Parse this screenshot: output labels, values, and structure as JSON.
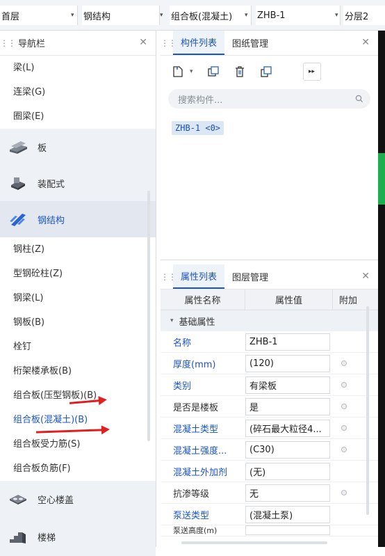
{
  "topbar": {
    "floor": "首层",
    "category": "钢结构",
    "component_type": "组合板(混凝土)",
    "component": "ZHB-1",
    "layer": "分层2"
  },
  "nav": {
    "title": "导航栏",
    "items_top": [
      "梁(L)",
      "连梁(G)",
      "圈梁(E)"
    ],
    "cat_slab": "板",
    "cat_prefab": "装配式",
    "cat_steel": "钢结构",
    "steel_items": [
      "钢柱(Z)",
      "型钢砼柱(Z)",
      "钢梁(L)",
      "钢板(B)",
      "栓钉",
      "桁架楼承板(B)",
      "组合板(压型钢板)(B)",
      "组合板(混凝土)(B)",
      "组合板受力筋(S)",
      "组合板负筋(F)"
    ],
    "cat_hollow": "空心楼盖",
    "cat_stairs": "楼梯"
  },
  "component_panel": {
    "tab_list": "构件列表",
    "tab_drawings": "图纸管理",
    "search_placeholder": "搜索构件...",
    "item": "ZHB-1 <0>"
  },
  "property_panel": {
    "tab_props": "属性列表",
    "tab_layers": "图层管理",
    "col_name": "属性名称",
    "col_value": "属性值",
    "col_extra": "附加",
    "group": "基础属性",
    "rows": [
      {
        "name": "名称",
        "value": "ZHB-1"
      },
      {
        "name": "厚度(mm)",
        "value": "(120)"
      },
      {
        "name": "类别",
        "value": "有梁板"
      },
      {
        "name": "是否是楼板",
        "value": "是"
      },
      {
        "name": "混凝土类型",
        "value": "(碎石最大粒径4..."
      },
      {
        "name": "混凝土强度...",
        "value": "(C30)"
      },
      {
        "name": "混凝土外加剂",
        "value": "(无)"
      },
      {
        "name": "抗渗等级",
        "value": "无"
      },
      {
        "name": "泵送类型",
        "value": "(混凝土泵)"
      },
      {
        "name": "泵送高度(m)",
        "value": ""
      }
    ]
  },
  "colors": {
    "accent": "#1a55c8",
    "annotation": "#e02020",
    "side_green": "#1dae4d"
  },
  "icons": [
    "grip-icon",
    "close-icon",
    "new-icon",
    "copy-icon",
    "delete-icon",
    "layer-copy-icon",
    "more-icon",
    "search-icon",
    "collapse-icon",
    "slab-icon",
    "prefab-icon",
    "steel-icon",
    "hollow-floor-icon",
    "stairs-icon"
  ]
}
